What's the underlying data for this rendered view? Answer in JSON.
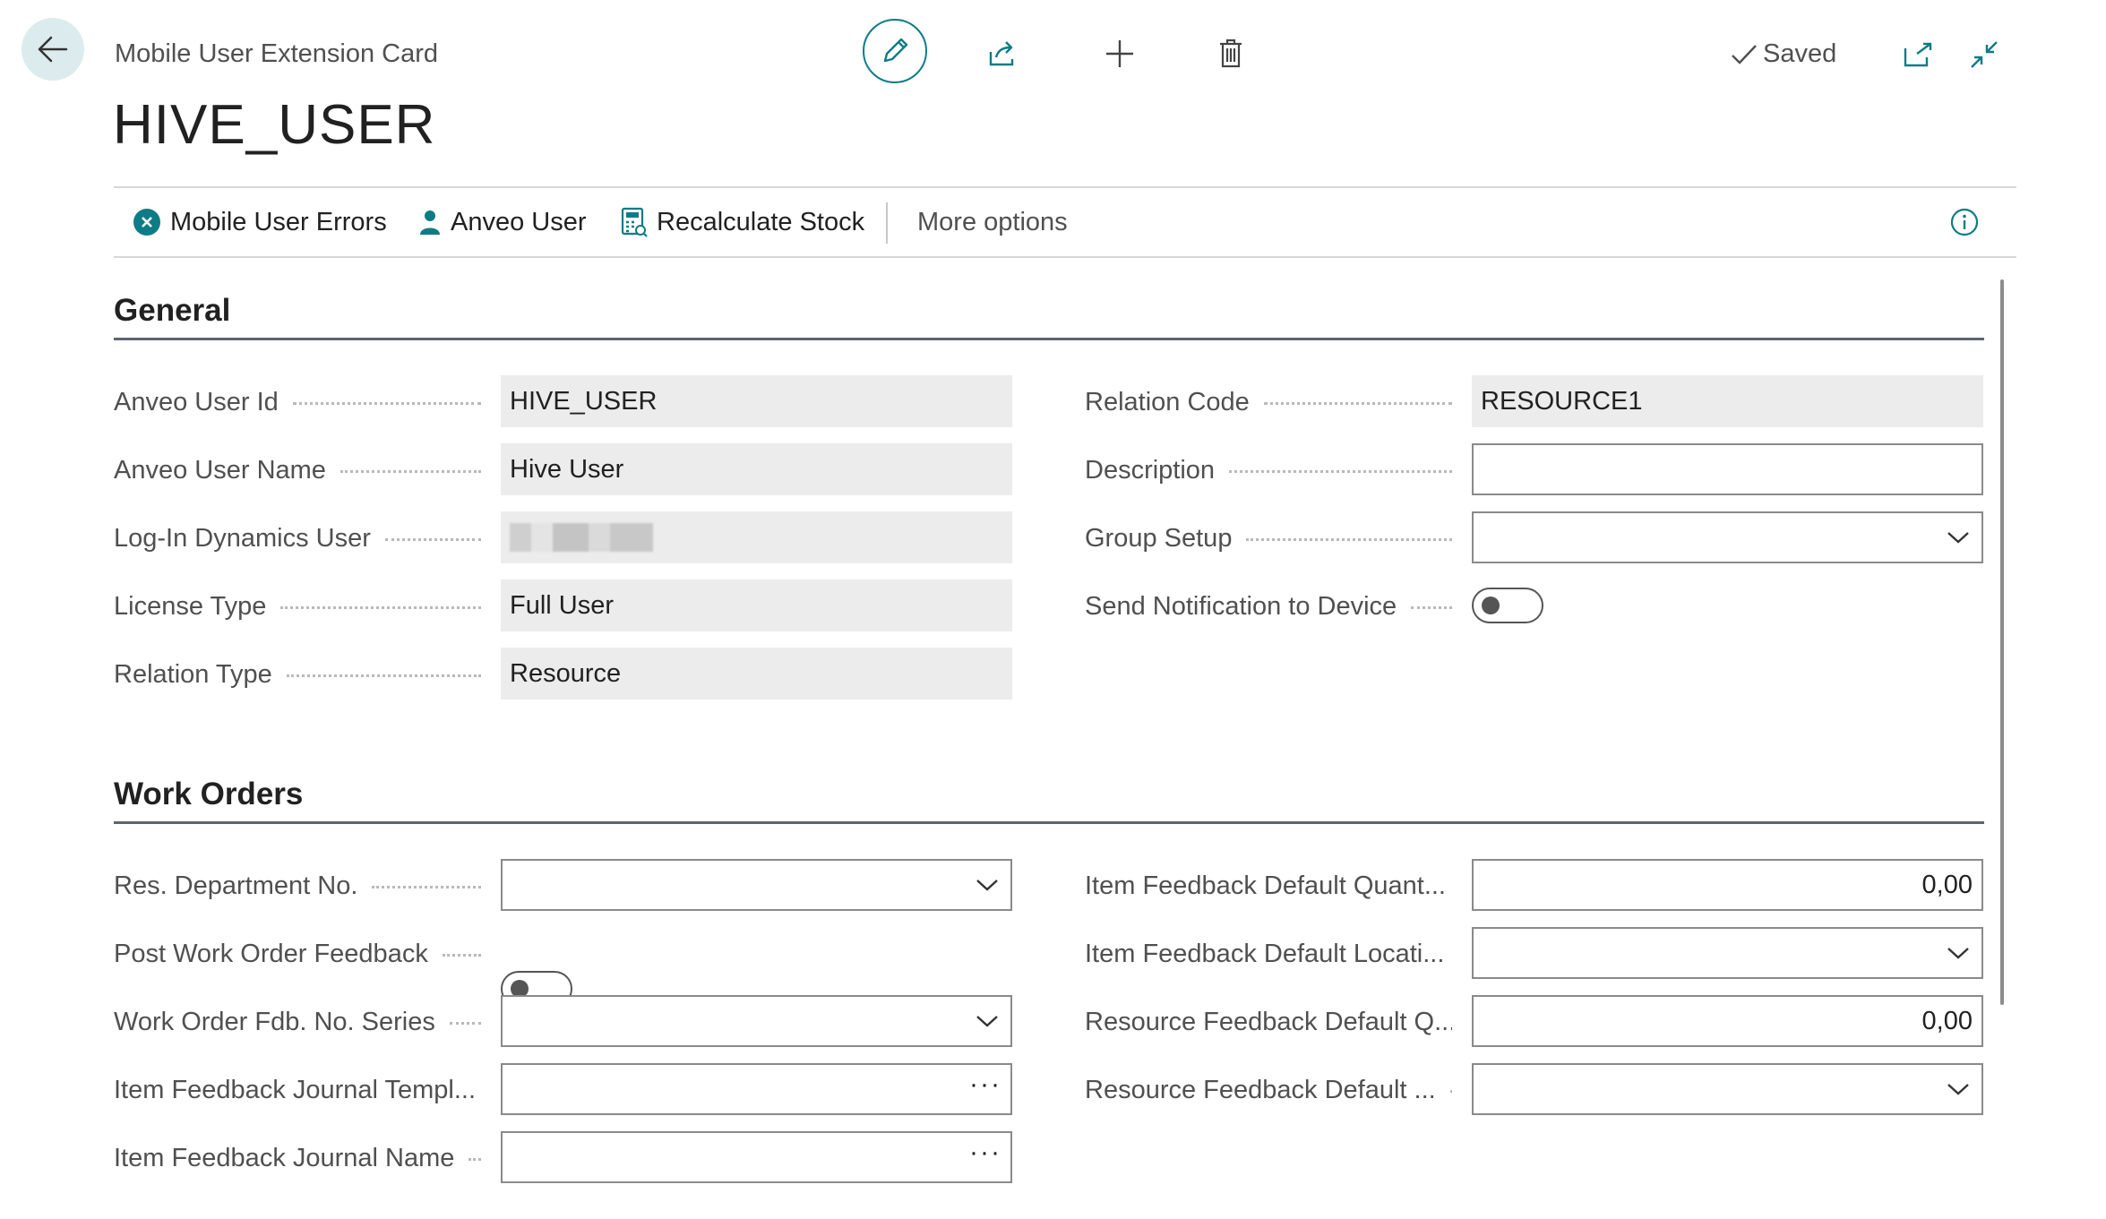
{
  "header": {
    "caption": "Mobile User Extension Card",
    "title": "HIVE_USER",
    "saved_label": "Saved",
    "icons": [
      "back-arrow-icon",
      "edit-pencil-icon",
      "share-icon",
      "plus-icon",
      "trash-icon",
      "checkmark-icon",
      "open-new-window-icon",
      "collapse-icon"
    ],
    "accent_color": "#0e7c86"
  },
  "actions": {
    "mobile_user_errors": "Mobile User Errors",
    "anveo_user": "Anveo User",
    "recalculate_stock": "Recalculate Stock",
    "more_options": "More options"
  },
  "general": {
    "title": "General",
    "anveo_user_id": {
      "label": "Anveo User Id",
      "value": "HIVE_USER"
    },
    "anveo_user_name": {
      "label": "Anveo User Name",
      "value": "Hive User"
    },
    "login_dynamics_user": {
      "label": "Log-In Dynamics User",
      "value": ""
    },
    "license_type": {
      "label": "License Type",
      "value": "Full User"
    },
    "relation_type": {
      "label": "Relation Type",
      "value": "Resource"
    },
    "relation_code": {
      "label": "Relation Code",
      "value": "RESOURCE1"
    },
    "description": {
      "label": "Description",
      "value": ""
    },
    "group_setup": {
      "label": "Group Setup",
      "value": ""
    },
    "send_notification": {
      "label": "Send Notification to Device",
      "value": false
    }
  },
  "work_orders": {
    "title": "Work Orders",
    "res_department_no": {
      "label": "Res. Department No.",
      "value": ""
    },
    "post_work_order_feedback": {
      "label": "Post Work Order Feedback",
      "value": false
    },
    "work_order_fdb_no_series": {
      "label": "Work Order Fdb. No. Series",
      "value": ""
    },
    "item_feedback_journal_templ": {
      "label": "Item Feedback Journal Templ...",
      "value": ""
    },
    "item_feedback_journal_name": {
      "label": "Item Feedback Journal Name",
      "value": ""
    },
    "item_feedback_default_quant": {
      "label": "Item Feedback Default Quant...",
      "value": "0,00"
    },
    "item_feedback_default_locati": {
      "label": "Item Feedback Default Locati...",
      "value": ""
    },
    "resource_feedback_default_q": {
      "label": "Resource Feedback Default Q...",
      "value": "0,00"
    },
    "resource_feedback_default": {
      "label": "Resource Feedback Default ...",
      "value": ""
    },
    "ellipsis": "···"
  }
}
